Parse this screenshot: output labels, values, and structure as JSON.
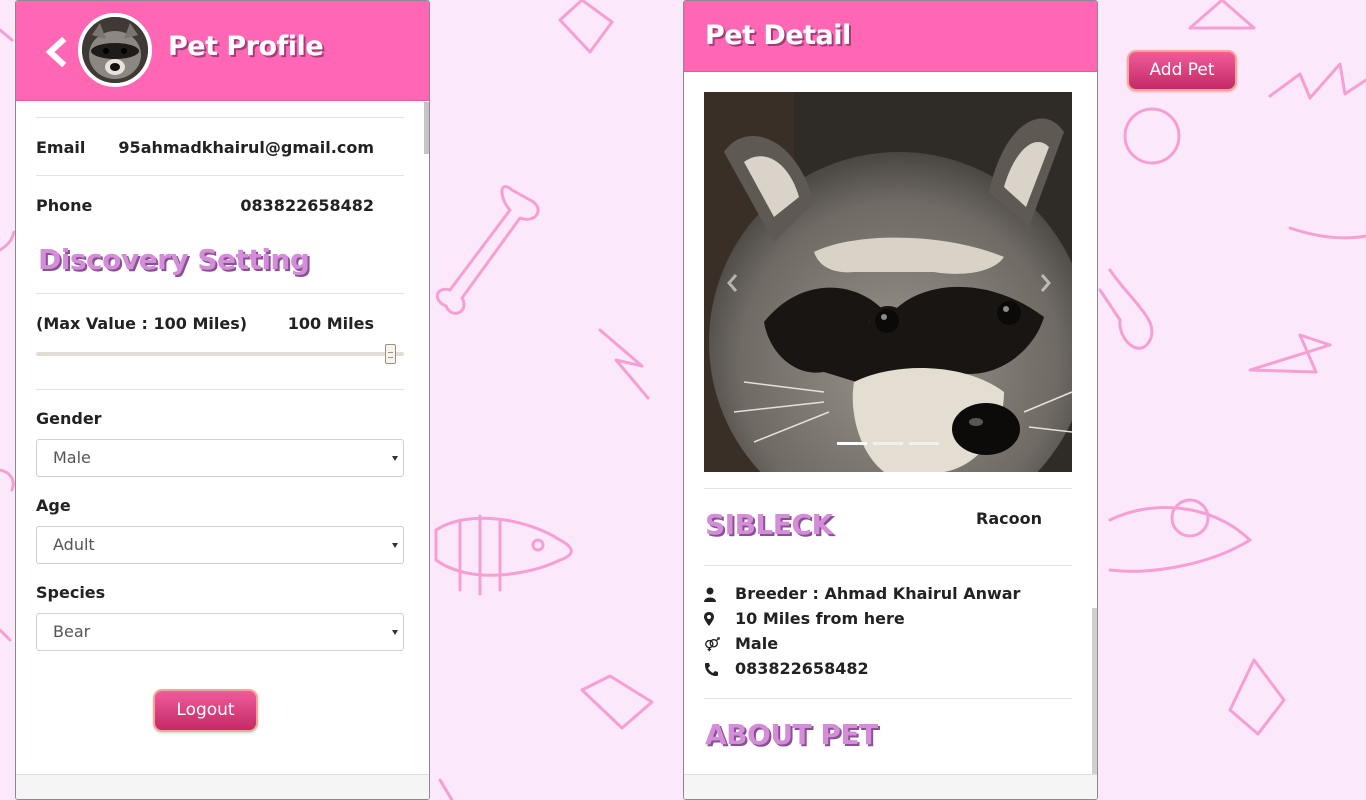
{
  "left_panel": {
    "title": "Pet Profile",
    "rows": [
      {
        "label": "Email",
        "value": "95ahmadkhairul@gmail.com"
      },
      {
        "label": "Phone",
        "value": "083822658482"
      }
    ],
    "discovery": {
      "title": "Discovery Setting",
      "max_label": "(Max Value : 100 Miles)",
      "max_value": "100 Miles",
      "slider_fraction": 1.0
    },
    "gender": {
      "label": "Gender",
      "value": "Male"
    },
    "age": {
      "label": "Age",
      "value": "Adult"
    },
    "species": {
      "label": "Species",
      "value": "Bear"
    },
    "logout_label": "Logout"
  },
  "right_panel": {
    "title": "Pet Detail",
    "carousel": {
      "slides": 3,
      "active": 1
    },
    "pet_name": "SIBLECK",
    "pet_type": "Racoon",
    "info": {
      "breeder": "Breeder : Ahmad Khairul Anwar",
      "distance": "10 Miles from here",
      "gender": "Male",
      "phone": "083822658482"
    },
    "about_title": "ABOUT PET"
  },
  "add_pet_label": "Add Pet",
  "colors": {
    "header_pink": "#ff66b3",
    "background": "#fce8fb",
    "heading_lilac": "#d48ed9",
    "button_gradient": "#c42a65"
  }
}
